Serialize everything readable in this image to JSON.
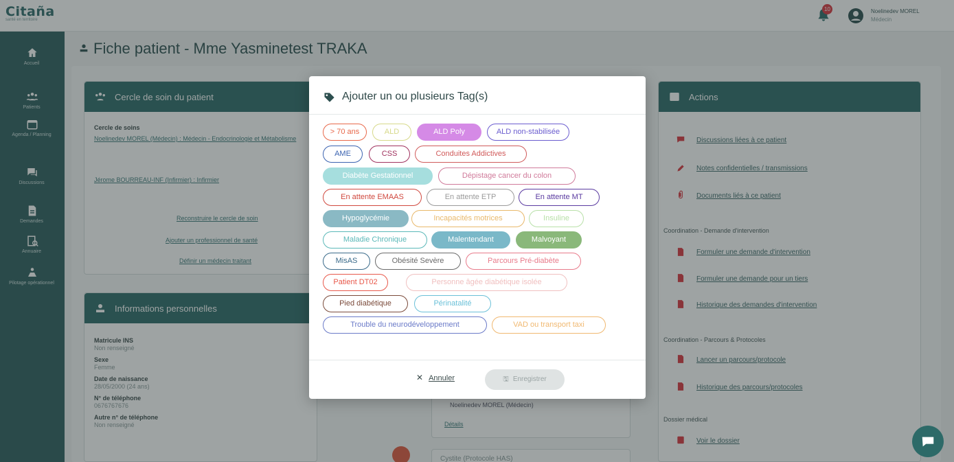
{
  "app": {
    "logo": "Citaña",
    "logo_sub": "santé en territoire",
    "notification_count": "10",
    "user_name": "Noelinedev MOREL",
    "user_role": "Médecin"
  },
  "sidebar": {
    "items": [
      {
        "label": "Accueil",
        "icon": "home-icon"
      },
      {
        "label": "Patients",
        "icon": "patients-icon"
      },
      {
        "label": "Agenda / Planning",
        "icon": "calendar-icon"
      },
      {
        "label": "Discussions",
        "icon": "chat-icon"
      },
      {
        "label": "Demandes",
        "icon": "document-icon"
      },
      {
        "label": "Annuaire",
        "icon": "directory-icon"
      },
      {
        "label": "Pilotage opérationnel",
        "icon": "steering-icon"
      }
    ]
  },
  "page": {
    "title": "Fiche patient - Mme Yasminetest TRAKA"
  },
  "care_circle": {
    "header": "Cercle de soin du patient",
    "label": "Cercle de soins",
    "member1": "Noelinedev MOREL (Médecin) : Médecin - Endocrinologie et Métabolisme",
    "member2": "Jérome BOURREAU-INF (Infirmier) : Infirmier",
    "link1": "Reconstruire le cercle de soin",
    "link2": "Ajouter un professionnel de santé",
    "link3": "Définir un médecin traitant"
  },
  "personal_info": {
    "header": "Informations personnelles",
    "fields": [
      {
        "label": "Matricule INS",
        "value": "Non renseigné"
      },
      {
        "label": "Sexe",
        "value": "Femme"
      },
      {
        "label": "Date de naissance",
        "value": "28/05/2000 (24 ans)"
      },
      {
        "label": "N° de téléphone",
        "value": "0676767676"
      },
      {
        "label": "Autre n° de téléphone",
        "value": "Non renseigné"
      }
    ]
  },
  "middle": {
    "author": "Noelinedev MOREL (Médecin)",
    "details_link": "Détails",
    "protocol": "Cystite (Protocole HAS)"
  },
  "actions": {
    "header": "Actions",
    "links": [
      "Discussions liées à ce patient",
      "Notes confidentielles / transmissions",
      "Documents liés à ce patient"
    ],
    "section1": "Coordination - Demande d'intervention",
    "section1_links": [
      "Formuler une demande d'intervention",
      "Formuler une demande pour un tiers",
      "Historique des demandes d'intervention"
    ],
    "section2": "Coordination - Parcours & Protocoles",
    "section2_links": [
      "Lancer un parcours/protocole",
      "Historique des parcours/protocoles"
    ],
    "section3": "Dossier médical",
    "section3_links": [
      "Voir le dossier"
    ]
  },
  "modal": {
    "title": "Ajouter un ou plusieurs Tag(s)",
    "tags": [
      {
        "label": "> 70 ans",
        "color": "#e8684a",
        "filled": false
      },
      {
        "label": "ALD",
        "color": "#d7d98a",
        "filled": false
      },
      {
        "label": "ALD Poly",
        "color": "#d58ae6",
        "filled": true
      },
      {
        "label": "ALD non-stabilisée",
        "color": "#6a5ccf",
        "filled": false
      },
      {
        "label": "AME",
        "color": "#3b63b0",
        "filled": false
      },
      {
        "label": "CSS",
        "color": "#a0315e",
        "filled": false
      },
      {
        "label": "Conduites Addictives",
        "color": "#d05a5a",
        "filled": false
      },
      {
        "label": "Diabète Gestationnel",
        "color": "#a6dede",
        "filled": true
      },
      {
        "label": "Dépistage cancer du colon",
        "color": "#d07a9a",
        "filled": false
      },
      {
        "label": "En attente EMAAS",
        "color": "#d0483e",
        "filled": false
      },
      {
        "label": "En attente ETP",
        "color": "#9a9a9a",
        "filled": false
      },
      {
        "label": "En attente MT",
        "color": "#5a3aa0",
        "filled": false
      },
      {
        "label": "Hypoglycémie",
        "color": "#8ab9c4",
        "filled": true
      },
      {
        "label": "Incapacités motrices",
        "color": "#e8b86a",
        "filled": false
      },
      {
        "label": "Insuline",
        "color": "#b8e0a8",
        "filled": false
      },
      {
        "label": "Maladie Chronique",
        "color": "#5ab8b8",
        "filled": false
      },
      {
        "label": "Malentendant",
        "color": "#7ab8c8",
        "filled": true
      },
      {
        "label": "Malvoyant",
        "color": "#8ab87a",
        "filled": true
      },
      {
        "label": "MisAS",
        "color": "#3a6a8a",
        "filled": false
      },
      {
        "label": "Obésité Sevère",
        "color": "#6a6a6a",
        "filled": false
      },
      {
        "label": "Parcours Pré-diabète",
        "color": "#e87a8a",
        "filled": false
      },
      {
        "label": "Patient DT02",
        "color": "#e8584a",
        "filled": false
      },
      {
        "label": "Personne âgée diabétique isolée",
        "color": "#f0c0c0",
        "filled": false
      },
      {
        "label": "Pied diabétique",
        "color": "#7a4a3a",
        "filled": false
      },
      {
        "label": "Périnatalité",
        "color": "#6ac0d8",
        "filled": false
      },
      {
        "label": "Trouble du neurodéveloppement",
        "color": "#6a7ac8",
        "filled": false
      },
      {
        "label": "VAD ou transport taxi",
        "color": "#f0b870",
        "filled": false
      }
    ],
    "cancel_label": "Annuler",
    "save_label": "Enregistrer"
  }
}
